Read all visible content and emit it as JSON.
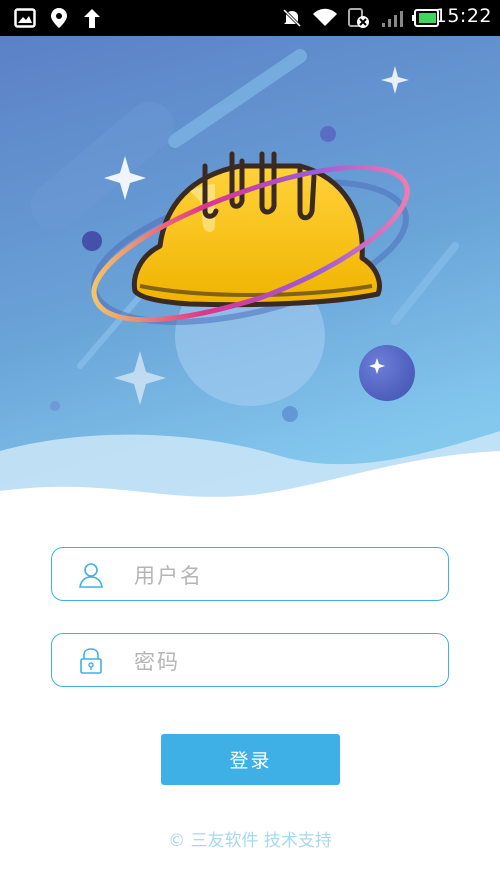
{
  "status_bar": {
    "time": "15:22",
    "icons": [
      "gallery-icon",
      "location-icon",
      "upload-arrow-icon",
      "mute-icon",
      "wifi-icon",
      "sim-disabled-icon",
      "signal-icon",
      "battery-icon"
    ]
  },
  "login_form": {
    "username_placeholder": "用户名",
    "password_placeholder": "密码",
    "login_label": "登录",
    "username_icon": "user-icon",
    "password_icon": "lock-icon"
  },
  "footer": {
    "text": "© 三友软件 技术支持"
  },
  "colors": {
    "accent": "#3fb0e6",
    "hero_top": "#5b86c6",
    "hero_bottom": "#7ec3ea",
    "helmet": "#f5c11a",
    "footer_text": "#a6d8f0"
  }
}
